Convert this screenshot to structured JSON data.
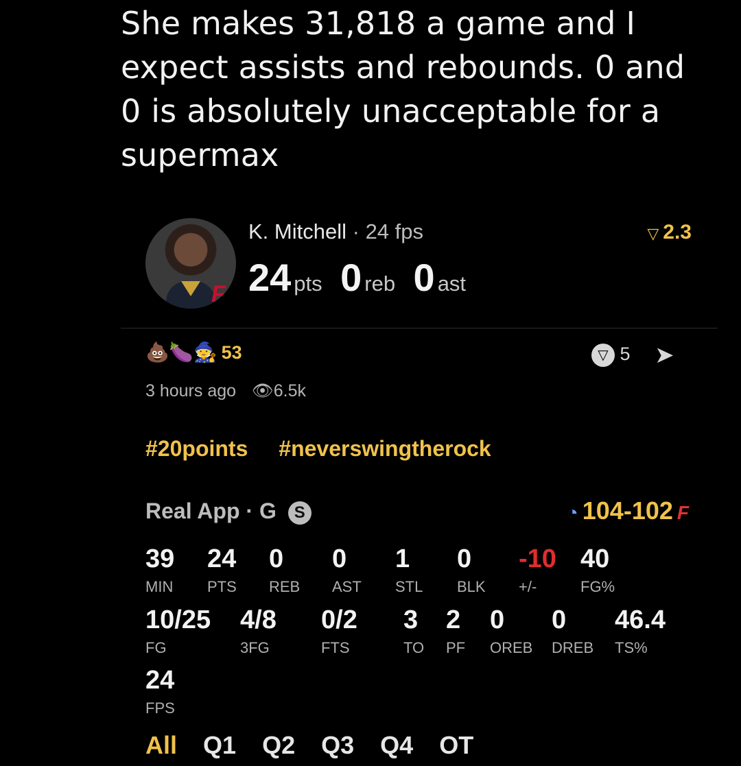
{
  "caption": "She makes 31,818 a game and I expect assists and rebounds. 0 and 0 is absolutely unacceptable for a supermax",
  "player": {
    "name": "K. Mitchell",
    "sep": "·",
    "fps": "24 fps",
    "pts": "24",
    "pts_label": "pts",
    "reb": "0",
    "reb_label": "reb",
    "ast": "0",
    "ast_label": "ast",
    "rating": "2.3"
  },
  "reactions": {
    "emojis": "💩🍆🧙",
    "count": "53"
  },
  "share_count": "5",
  "meta": {
    "time": "3 hours ago",
    "views": "6.5k"
  },
  "tags": [
    "#20points",
    "#neverswingtherock"
  ],
  "game": {
    "app": "Real App",
    "pos": "G",
    "badge": "S",
    "score": "104-102"
  },
  "stats_row1": [
    {
      "v": "39",
      "l": "MIN"
    },
    {
      "v": "24",
      "l": "PTS"
    },
    {
      "v": "0",
      "l": "REB"
    },
    {
      "v": "0",
      "l": "AST"
    },
    {
      "v": "1",
      "l": "STL"
    },
    {
      "v": "0",
      "l": "BLK"
    },
    {
      "v": "-10",
      "l": "+/-"
    },
    {
      "v": "40",
      "l": "FG%"
    }
  ],
  "stats_row2": [
    {
      "v": "10/25",
      "l": "FG"
    },
    {
      "v": "4/8",
      "l": "3FG"
    },
    {
      "v": "0/2",
      "l": "FTS"
    },
    {
      "v": "3",
      "l": "TO"
    },
    {
      "v": "2",
      "l": "PF"
    },
    {
      "v": "0",
      "l": "OREB"
    },
    {
      "v": "0",
      "l": "DREB"
    },
    {
      "v": "46.4",
      "l": "TS%"
    }
  ],
  "stats_row3": [
    {
      "v": "24",
      "l": "FPS"
    }
  ],
  "tabs": [
    "All",
    "Q1",
    "Q2",
    "Q3",
    "Q4",
    "OT"
  ],
  "colors": {
    "accent": "#f0c24b",
    "negative": "#e02d2d",
    "background": "#000000"
  }
}
